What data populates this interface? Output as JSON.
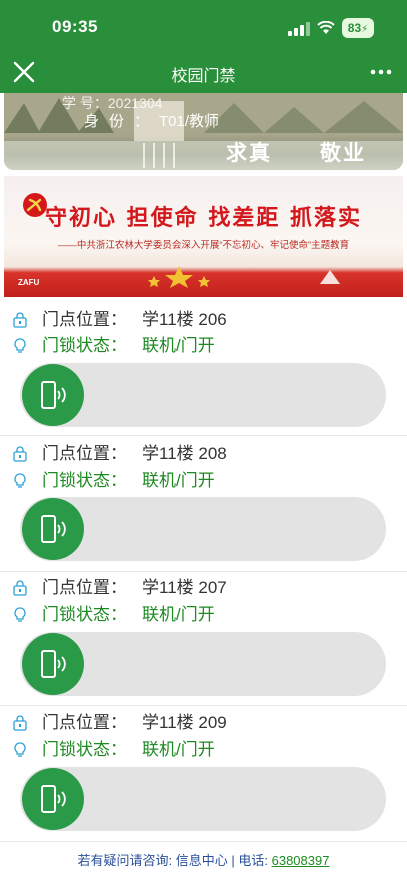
{
  "status_bar": {
    "time": "09:35",
    "battery": "83"
  },
  "nav": {
    "title": "校园门禁"
  },
  "photo": {
    "id_line_prefix": "学    号：",
    "id_line_value": "2021304",
    "role_label": "身份：",
    "role_value": "T01/教师",
    "calligraphy_left": "求真",
    "calligraphy_right": "敬业"
  },
  "banner": {
    "slogan": "守初心 担使命 找差距 抓落实",
    "subtitle": "——中共浙江农林大学委员会深入开展“不忘初心、牢记使命”主题教育",
    "mark": "ZAFU"
  },
  "labels": {
    "position": "门点位置：",
    "lock_status": "门锁状态："
  },
  "doors": [
    {
      "position": "学11楼 206",
      "status": "联机/门开"
    },
    {
      "position": "学11楼 208",
      "status": "联机/门开"
    },
    {
      "position": "学11楼 207",
      "status": "联机/门开"
    },
    {
      "position": "学11楼 209",
      "status": "联机/门开"
    }
  ],
  "footer": {
    "text": "若有疑问请咨询: 信息中心 | 电话: ",
    "phone": "63808397"
  },
  "colors": {
    "brand_green": "#2a8f3a",
    "status_green": "#1d8a22",
    "knob_green": "#2a9a49",
    "footer_blue": "#2a4f9a"
  },
  "icons": {
    "door_icon": "door-lock-icon",
    "lock_icon": "lightbulb-icon",
    "knob_icon": "phone-nfc-icon"
  }
}
